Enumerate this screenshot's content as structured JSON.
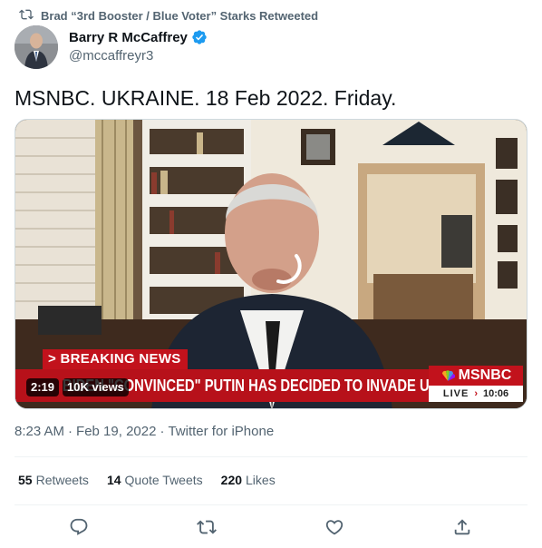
{
  "retweet_context": {
    "icon": "retweet-icon",
    "text": "Brad “3rd Booster / Blue Voter” Starks Retweeted"
  },
  "author": {
    "display_name": "Barry R McCaffrey",
    "handle": "@mccaffreyr3",
    "verified": true,
    "verified_color": "#1d9bf0"
  },
  "tweet": {
    "text": "MSNBC. UKRAINE. 18 Feb 2022. Friday."
  },
  "media": {
    "type": "video",
    "duration": "2:19",
    "views": "10K views",
    "ticker": {
      "breaking": "> BREAKING NEWS",
      "headline": "BIDEN \"CONVINCED\" PUTIN HAS DECIDED TO INVADE UKRAINE",
      "network": "MSNBC",
      "live": "LIVE",
      "time": "10:06",
      "brand_color": "#c2121c"
    }
  },
  "meta": {
    "time": "8:23 AM",
    "sep1": "·",
    "date": "Feb 19, 2022",
    "sep2": "·",
    "source": "Twitter for iPhone"
  },
  "stats": {
    "retweets": {
      "count": "55",
      "label": "Retweets"
    },
    "quote_tweets": {
      "count": "14",
      "label": "Quote Tweets"
    },
    "likes": {
      "count": "220",
      "label": "Likes"
    }
  },
  "actions": [
    "reply-icon",
    "retweet-icon",
    "like-icon",
    "share-icon"
  ]
}
